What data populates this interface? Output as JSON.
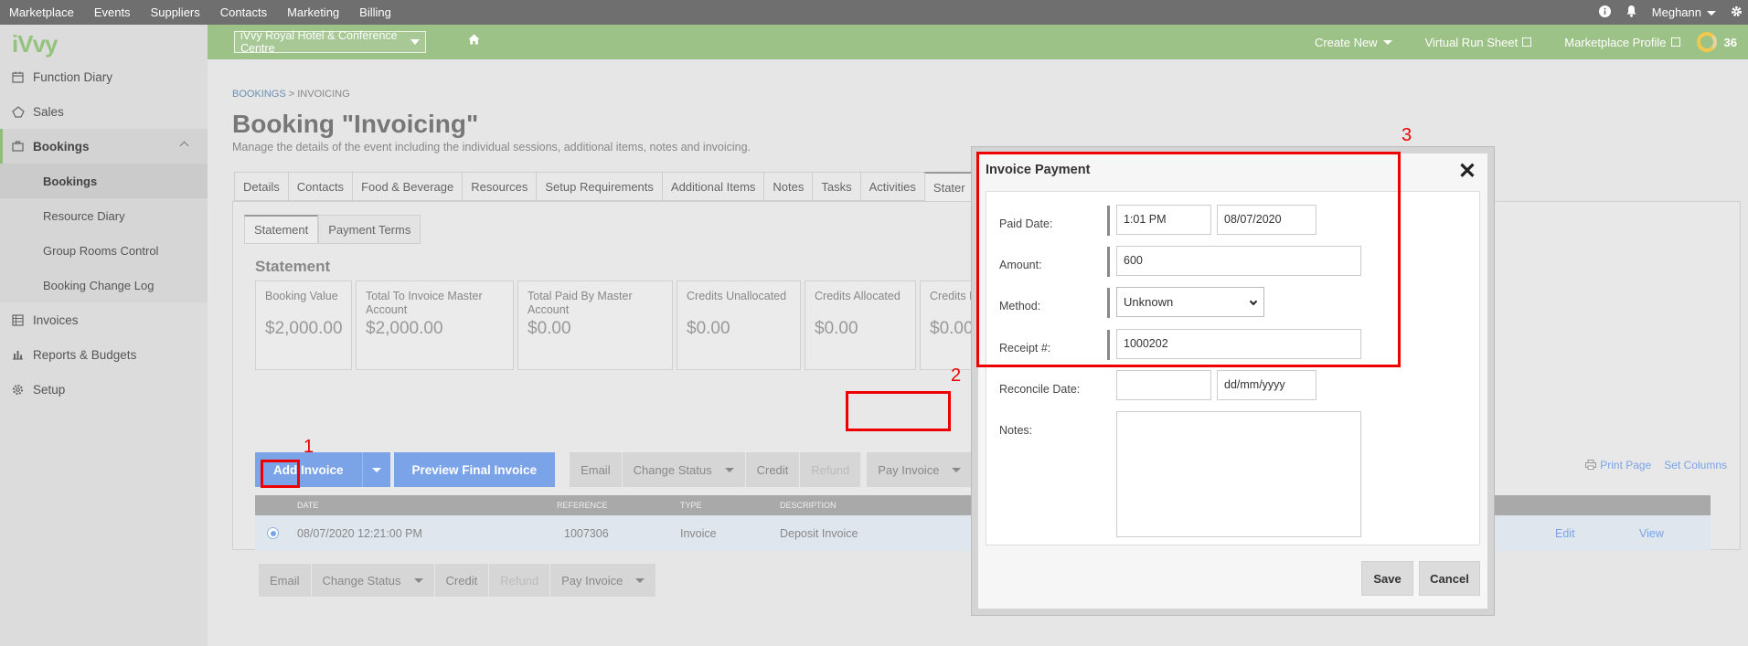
{
  "topnav": {
    "menu": [
      "Marketplace",
      "Events",
      "Suppliers",
      "Contacts",
      "Marketing",
      "Billing"
    ],
    "user": "Meghann",
    "icons": [
      "info-icon",
      "bell-icon",
      "gear-icon"
    ]
  },
  "greenbar": {
    "venue": "iVvy Royal Hotel & Conference Centre",
    "create_new": "Create New",
    "virtual_run_sheet": "Virtual Run Sheet",
    "marketplace_profile": "Marketplace Profile",
    "score": "36"
  },
  "sidebar": {
    "logo": "iVvy",
    "items": [
      {
        "label": "Function Diary",
        "icon": "calendar-icon"
      },
      {
        "label": "Sales",
        "icon": "sales-icon"
      },
      {
        "label": "Bookings",
        "icon": "briefcase-icon"
      },
      {
        "label": "Invoices",
        "icon": "invoice-icon"
      },
      {
        "label": "Reports & Budgets",
        "icon": "chart-icon"
      },
      {
        "label": "Setup",
        "icon": "gear-icon"
      }
    ],
    "sub_items": [
      "Bookings",
      "Resource Diary",
      "Group Rooms Control",
      "Booking Change Log"
    ]
  },
  "page": {
    "breadcrumb_link": "BOOKINGS",
    "breadcrumb_current": "INVOICING",
    "title": "Booking \"Invoicing\"",
    "subtitle": "Manage the details of the event including the individual sessions, additional items, notes and invoicing."
  },
  "tabs": [
    "Details",
    "Contacts",
    "Food & Beverage",
    "Resources",
    "Setup Requirements",
    "Additional Items",
    "Notes",
    "Tasks",
    "Activities",
    "Stater"
  ],
  "subtabs": [
    "Statement",
    "Payment Terms"
  ],
  "statement": {
    "title": "Statement",
    "cards": [
      {
        "label": "Booking Value",
        "value": "$2,000.00"
      },
      {
        "label": "Total To Invoice Master Account",
        "value": "$2,000.00"
      },
      {
        "label": "Total Paid By Master Account",
        "value": "$0.00"
      },
      {
        "label": "Credits Unallocated",
        "value": "$0.00"
      },
      {
        "label": "Credits Allocated",
        "value": "$0.00"
      },
      {
        "label": "Credits R",
        "value": "$0.00"
      }
    ]
  },
  "actions": {
    "add_invoice": "Add Invoice",
    "preview_final": "Preview Final Invoice",
    "email": "Email",
    "change_status": "Change Status",
    "credit": "Credit",
    "refund": "Refund",
    "pay_invoice": "Pay Invoice",
    "print_page": "Print Page",
    "set_columns": "Set Columns"
  },
  "table": {
    "headers": {
      "date": "DATE",
      "reference": "REFERENCE",
      "type": "TYPE",
      "description": "DESCRIPTION"
    },
    "row": {
      "date": "08/07/2020 12:21:00 PM",
      "reference": "1007306",
      "type": "Invoice",
      "description": "Deposit Invoice",
      "edit": "Edit",
      "view": "View"
    }
  },
  "annotations": [
    "1",
    "2",
    "3"
  ],
  "modal": {
    "title": "Invoice Payment",
    "paid_date_label": "Paid Date:",
    "paid_time": "1:01 PM",
    "paid_date": "08/07/2020",
    "amount_label": "Amount:",
    "amount": "600",
    "method_label": "Method:",
    "method": "Unknown",
    "receipt_label": "Receipt #:",
    "receipt": "1000202",
    "reconcile_label": "Reconcile Date:",
    "reconcile_placeholder": "dd/mm/yyyy",
    "notes_label": "Notes:",
    "save": "Save",
    "cancel": "Cancel"
  },
  "colors": {
    "topnav": "#6f6f6f",
    "greenbar": "#9dc287",
    "primary_button": "#7aa3e8",
    "annotation": "#ee0000"
  }
}
